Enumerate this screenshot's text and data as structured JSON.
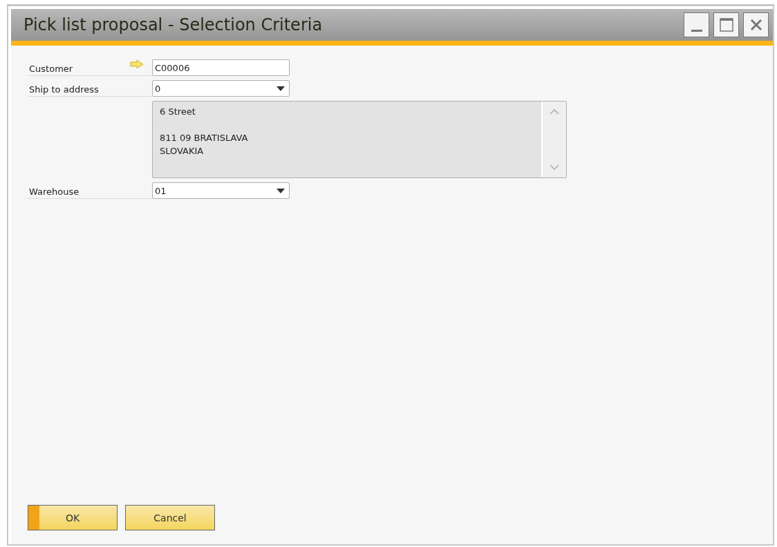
{
  "window": {
    "title": "Pick list proposal - Selection Criteria"
  },
  "fields": [
    {
      "kind": "text",
      "label": "Customer",
      "value": "C00006",
      "link_arrow": true
    },
    {
      "kind": "dropdown",
      "label": "Ship to address",
      "value": "0",
      "link_arrow": false
    },
    {
      "kind": "address",
      "value": "6 Street\n\n811 09 BRATISLAVA\nSLOVAKIA"
    },
    {
      "kind": "dropdown",
      "label": "Warehouse",
      "value": "01",
      "link_arrow": false
    }
  ],
  "buttons": [
    {
      "label": "OK",
      "default": true
    },
    {
      "label": "Cancel",
      "default": false
    }
  ]
}
